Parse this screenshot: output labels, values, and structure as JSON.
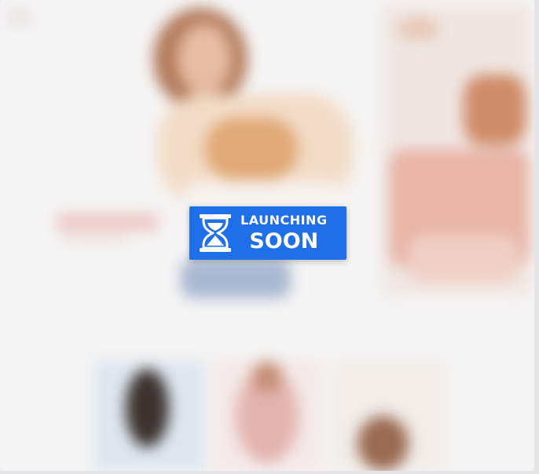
{
  "badge": {
    "line1": "LAUNCHING",
    "line2": "SOON",
    "icon": "hourglass-icon",
    "bg_color": "#1f6fe8",
    "text_color": "#ffffff"
  },
  "colors": {
    "background": "#f5f4f4",
    "accent": "#1f6fe8"
  }
}
